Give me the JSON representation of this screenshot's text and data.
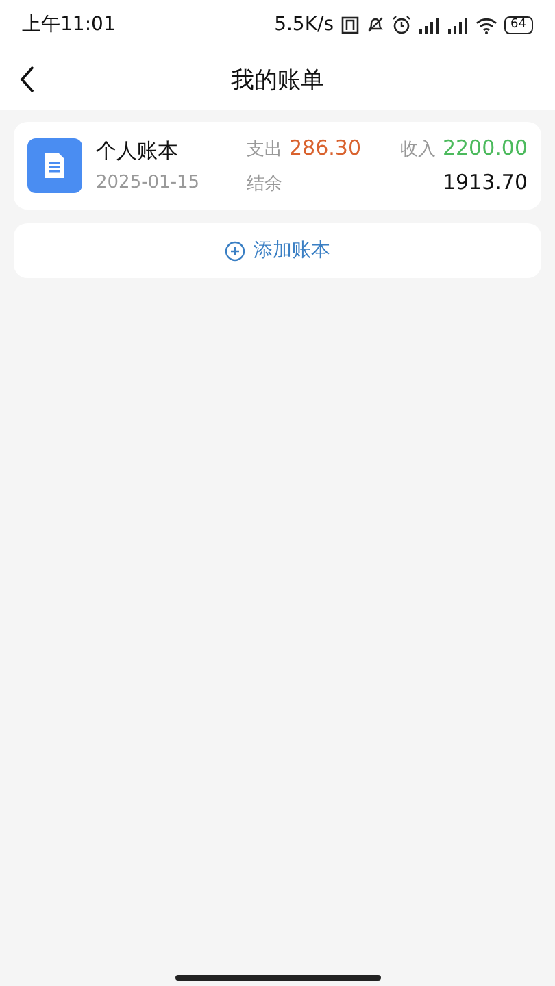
{
  "status_bar": {
    "time": "上午11:01",
    "speed": "5.5K/s",
    "battery": "64"
  },
  "header": {
    "title": "我的账单"
  },
  "books": [
    {
      "name": "个人账本",
      "date": "2025-01-15",
      "expense_label": "支出",
      "expense": "286.30",
      "income_label": "收入",
      "income": "2200.00",
      "balance_label": "结余",
      "balance": "1913.70"
    }
  ],
  "add_button": {
    "label": "添加账本"
  }
}
